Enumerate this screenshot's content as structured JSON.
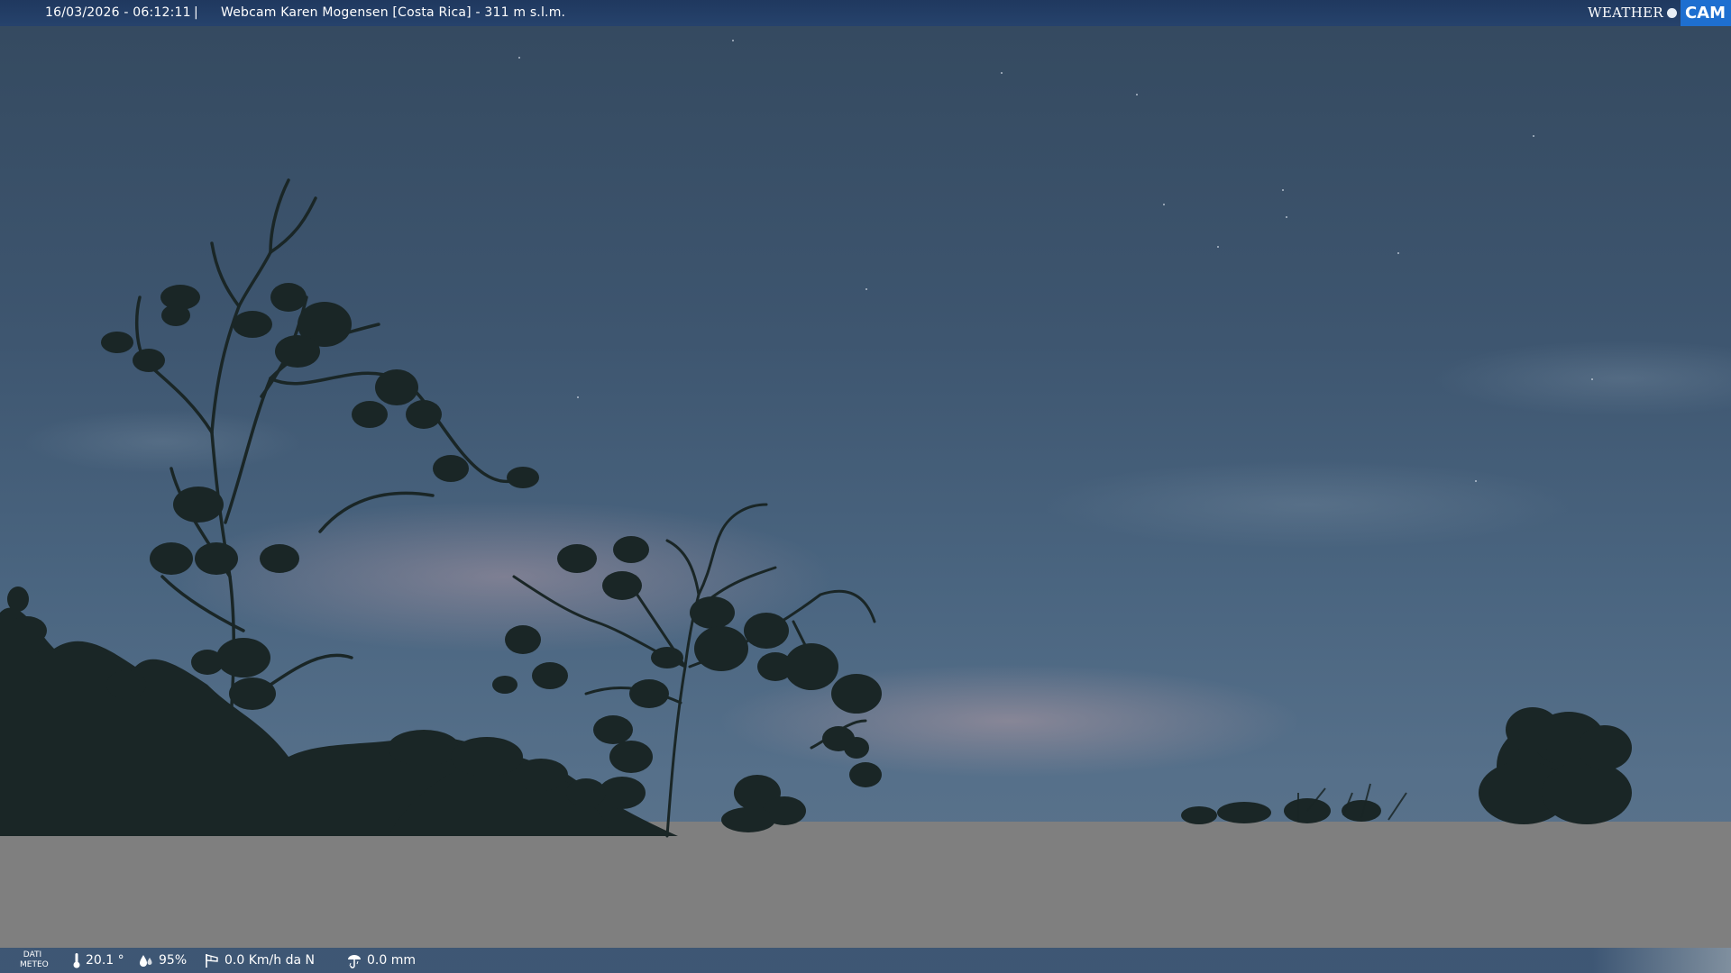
{
  "header": {
    "timestamp": "16/03/2026 - 06:12:11",
    "separator": "|",
    "camera_name": "Webcam Karen Mogensen [Costa Rica]  - 311 m s.l.m.",
    "logo_left": "WEATHER",
    "logo_right": "CAM"
  },
  "footer": {
    "label": "DATI METEO",
    "temperature": "20.1 °",
    "humidity": "95%",
    "wind": "0.0 Km/h da N",
    "rain": "0.0 mm"
  },
  "icons": {
    "temperature": "thermometer-icon",
    "humidity": "humidity-drops-icon",
    "wind": "wind-sock-icon",
    "rain": "rain-gauge-icon",
    "logo": "weathercam-logo"
  },
  "colors": {
    "header_bg": "#1e375f",
    "logo_accent": "#1e6fd0",
    "footer_bg": "#3c5573",
    "missing_area": "#7f7f7f"
  }
}
